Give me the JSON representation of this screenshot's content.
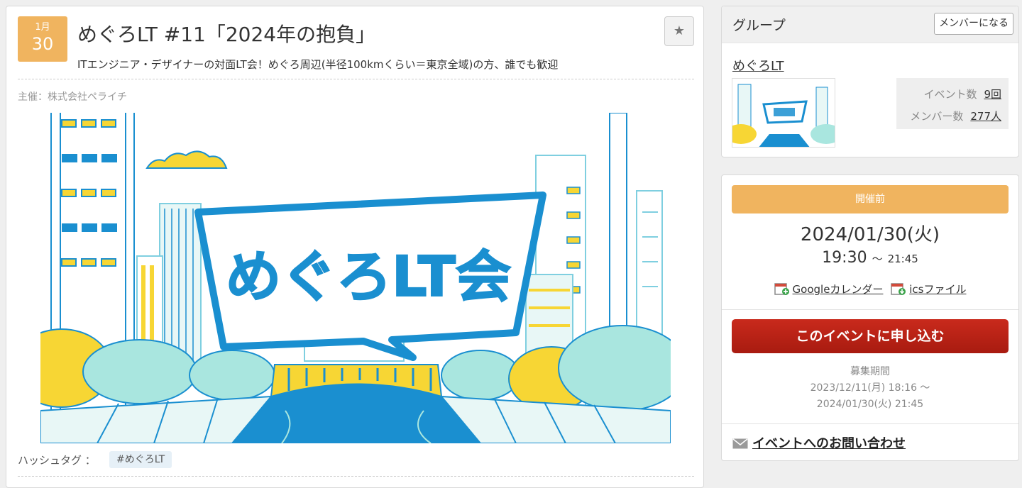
{
  "event": {
    "month": "1月",
    "day": "30",
    "title": "めぐろLT #11「2024年の抱負」",
    "catch": "ITエンジニア・デザイナーの対面LT会！めぐろ周辺(半径100kmくらい＝東京全域)の方、誰でも歓迎",
    "owner": "主催：株式会社ペライチ",
    "hero_logo_text": "めぐろLT会",
    "hashtag_label": "ハッシュタグ ：",
    "hashtag": "#めぐろLT"
  },
  "group": {
    "header": "グループ",
    "join_label": "メンバーになる",
    "name": "めぐろLT",
    "events_label": "イベント数",
    "events_value": "9回",
    "members_label": "メンバー数",
    "members_value": "277人"
  },
  "schedule": {
    "status": "開催前",
    "date": "2024/01/30(火)",
    "start": "19:30",
    "tilde": "～",
    "end": "21:45",
    "google_cal": "Googleカレンダー",
    "ics": "icsファイル",
    "apply_label": "このイベントに申し込む",
    "period_label": "募集期間",
    "period_start": "2023/12/11(月) 18:16 ～",
    "period_end": "2024/01/30(火) 21:45",
    "contact": "イベントへのお問い合わせ"
  },
  "colors": {
    "accent_orange": "#f0b45f",
    "apply_red": "#b8231a",
    "hero_blue": "#1a8fd0",
    "hero_yellow": "#f7d634",
    "hero_mint": "#a9e6df"
  },
  "icons": [
    "star-icon",
    "calendar-add-icon",
    "calendar-download-icon",
    "mail-icon"
  ]
}
